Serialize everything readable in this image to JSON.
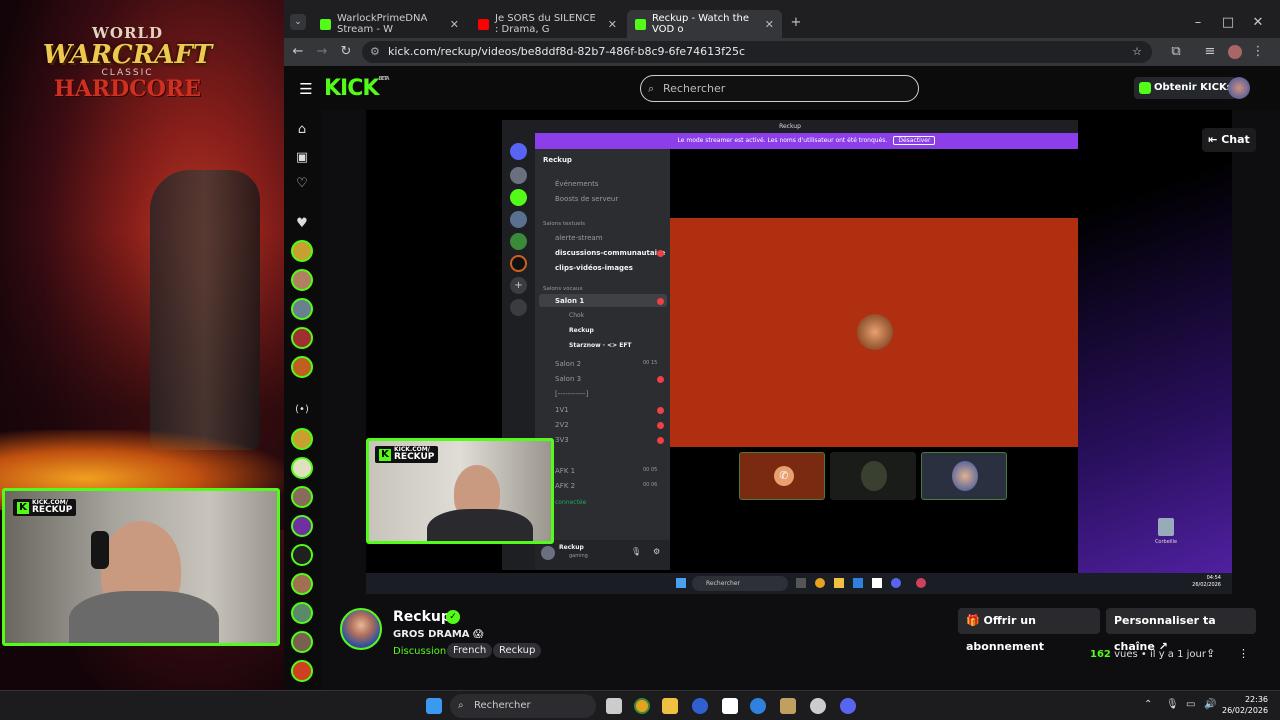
{
  "desktop": {
    "wow_logo": {
      "line1": "WORLD",
      "line2": "WARCRAFT",
      "line3": "CLASSIC",
      "line4": "HARDCORE"
    },
    "webcam_overlay": {
      "small": "KICK.COM/",
      "big": "RECKUP"
    }
  },
  "browser": {
    "tabs": [
      {
        "label": "WarlockPrimeDNA Stream - W",
        "favicon_color": "#53fc18"
      },
      {
        "label": "Je SORS du SILENCE : Drama, G",
        "favicon_color": "#ff0000"
      },
      {
        "label": "Reckup - Watch the VOD o",
        "favicon_color": "#53fc18"
      }
    ],
    "new_tab": "+",
    "url": "kick.com/reckup/videos/be8ddf8d-82b7-486f-b8c9-6fe74613f25c",
    "window_controls": [
      "–",
      "□",
      "✕"
    ]
  },
  "kick": {
    "logo": "KICK",
    "logo_beta": "BETA",
    "search_placeholder": "Rechercher",
    "kicks_button": "Obtenir KICKs",
    "chat_button": "Chat",
    "accent": "#53fc18"
  },
  "discord": {
    "window_title": "Reckup",
    "banner_text": "Le mode streamer est activé. Les noms d'utilisateur ont été tronqués.",
    "banner_button": "Désactiver",
    "server_name": "Reckup",
    "events": "Événements",
    "boosts": "Boosts de serveur",
    "text_category": "Salons textuels",
    "text_channels": [
      "alerte-stream",
      "discussions-communautaire",
      "clips-vidéos-images"
    ],
    "voice_category": "Salons vocaux",
    "voice_channels": [
      "Salon 1",
      "Salon 2",
      "Salon 3",
      "[-----------]",
      "1V1",
      "2V2",
      "3V3",
      "AFK 1",
      "AFK 2"
    ],
    "voice_members": [
      "Chok",
      "Reckup",
      "Starznow · <> EFT"
    ],
    "salon2_counts": [
      "00",
      "15"
    ],
    "afk1_counts": [
      "00",
      "05"
    ],
    "afk2_counts": [
      "00",
      "06"
    ],
    "connected": "connectée",
    "user_name": "Reckup",
    "user_status": "gaming"
  },
  "windows_inner": {
    "search": "Rechercher",
    "recycle_bin": "Corbeille",
    "time": "04:54",
    "date": "26/02/2026"
  },
  "channel": {
    "name": "Reckup",
    "title": "GROS DRAMA 😱",
    "category": "Discussion",
    "tags": [
      "French",
      "Reckup"
    ],
    "subscribe_button": "Offrir un abonnement",
    "customize_button": "Personnaliser ta chaîne",
    "views_count": "162",
    "views_label": "vues",
    "age": "il y a 1 jour"
  },
  "taskbar": {
    "search": "Rechercher",
    "time": "22:36",
    "date": "26/02/2026"
  }
}
